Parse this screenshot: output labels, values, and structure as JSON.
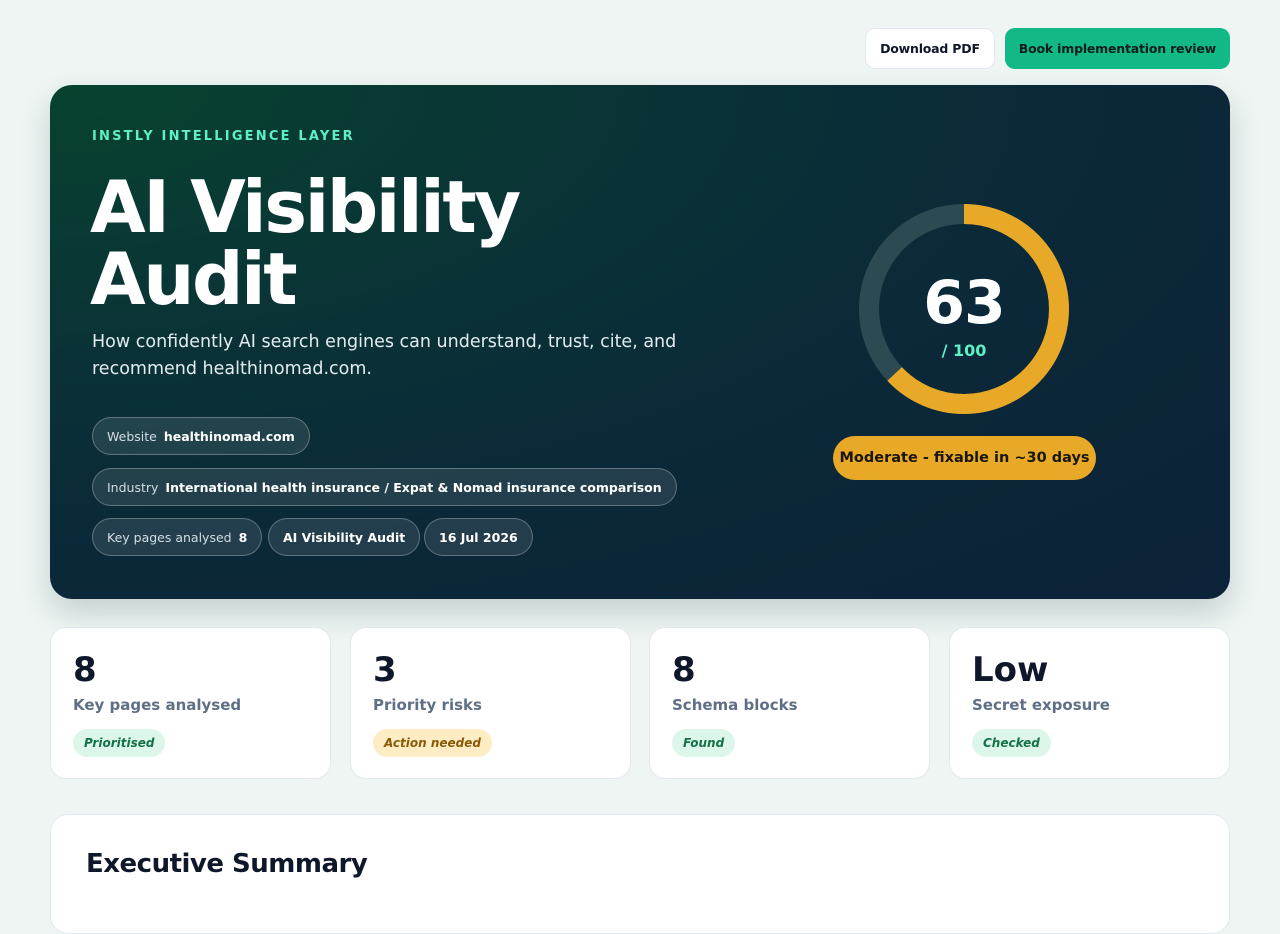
{
  "toolbar": {
    "download_label": "Download PDF",
    "book_label": "Book implementation review"
  },
  "hero": {
    "eyebrow": "INSTLY INTELLIGENCE LAYER",
    "title": "AI Visibility Audit",
    "subtitle": "How confidently AI search engines can understand, trust, cite, and recommend healthinomad.com.",
    "chips": {
      "website_key": "Website",
      "website_value": "healthinomad.com",
      "industry_key": "Industry",
      "industry_value": "International health insurance / Expat & Nomad insurance comparison",
      "pages_key": "Key pages analysed",
      "pages_value": "8",
      "audit_type": "AI Visibility Audit",
      "date": "16 Jul 2026"
    }
  },
  "score": {
    "value": 63,
    "display": "63",
    "max_label": "/ 100",
    "fraction": 0.63,
    "verdict": "Moderate - fixable in ~30 days",
    "colors": {
      "progress": "#e8a928",
      "track": "#2b4a52",
      "accent": "#5ff0c5"
    }
  },
  "stats": [
    {
      "value": "8",
      "label": "Key pages analysed",
      "badge": "Prioritised",
      "badge_tone": "green"
    },
    {
      "value": "3",
      "label": "Priority risks",
      "badge": "Action needed",
      "badge_tone": "amber"
    },
    {
      "value": "8",
      "label": "Schema blocks",
      "badge": "Found",
      "badge_tone": "green"
    },
    {
      "value": "Low",
      "label": "Secret exposure",
      "badge": "Checked",
      "badge_tone": "green"
    }
  ],
  "summary": {
    "heading": "Executive Summary"
  }
}
